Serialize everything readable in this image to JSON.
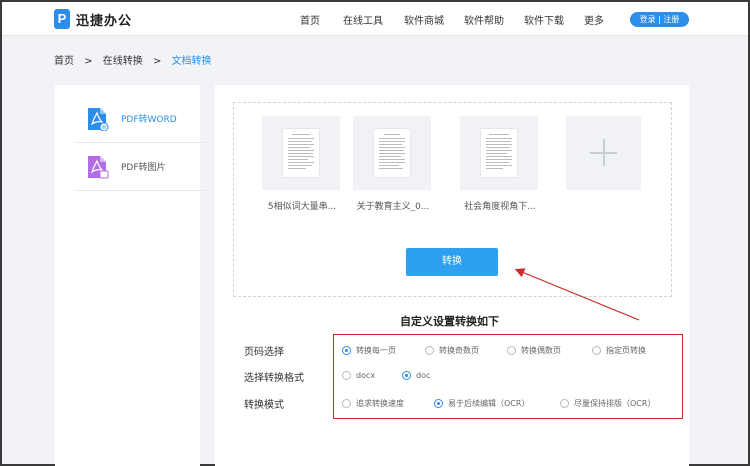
{
  "header": {
    "logo_badge": "P",
    "logo_text": "迅捷办公",
    "nav": [
      "首页",
      "在线工具",
      "软件商城",
      "软件帮助",
      "软件下载",
      "更多"
    ],
    "login": "登录 | 注册",
    "accent_color": "#2c8ee8"
  },
  "breadcrumb": {
    "items": [
      "首页",
      "在线转换",
      "文档转换"
    ],
    "separator": ">"
  },
  "sidebar": {
    "items": [
      {
        "label": "PDF转WORD",
        "icon": "pdf-to-word-icon",
        "active": true
      },
      {
        "label": "PDF转图片",
        "icon": "pdf-to-image-icon",
        "active": false
      }
    ]
  },
  "files": [
    {
      "name": "5相似词大量串..."
    },
    {
      "name": "关于教育主义_0..."
    },
    {
      "name": "社会角度视角下..."
    }
  ],
  "convert_button": "转换",
  "settings": {
    "title": "自定义设置转换如下",
    "rows": [
      {
        "label": "页码选择",
        "options": [
          "转换每一页",
          "转换奇数页",
          "转换偶数页",
          "指定页转换"
        ],
        "selected": 0
      },
      {
        "label": "选择转换格式",
        "options": [
          "docx",
          "doc"
        ],
        "selected": 1
      },
      {
        "label": "转换模式",
        "options": [
          "追求转换速度",
          "易于后续编辑（OCR）",
          "尽量保持排版（OCR）"
        ],
        "selected": 1
      }
    ]
  },
  "annotation_color": "#cf2b2b"
}
